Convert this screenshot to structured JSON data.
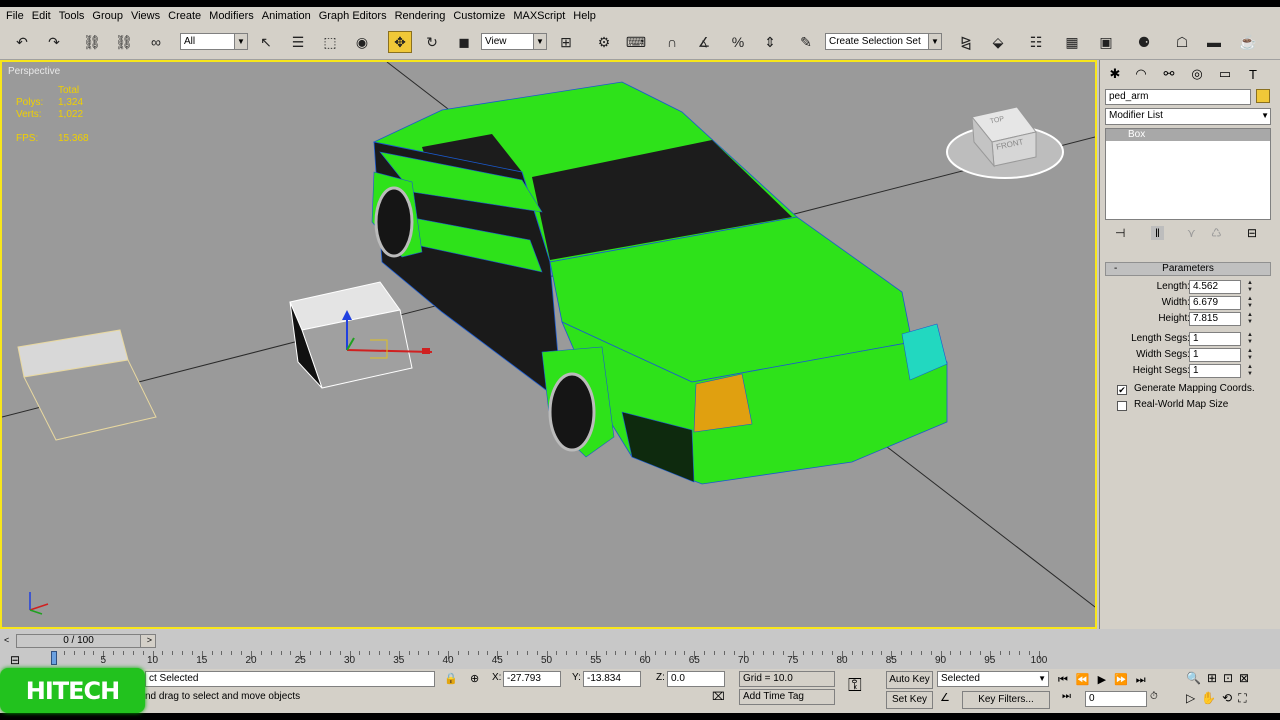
{
  "menu": [
    "File",
    "Edit",
    "Tools",
    "Group",
    "Views",
    "Create",
    "Modifiers",
    "Animation",
    "Graph Editors",
    "Rendering",
    "Customize",
    "MAXScript",
    "Help"
  ],
  "toolbar": {
    "filter_value": "All",
    "ref_coord_value": "View",
    "selection_set_placeholder": "Create Selection Set"
  },
  "viewport": {
    "label": "Perspective",
    "stats_header": "Total",
    "polys_label": "Polys:",
    "polys_value": "1,324",
    "verts_label": "Verts:",
    "verts_value": "1,022",
    "fps_label": "FPS:",
    "fps_value": "15.368",
    "viewcube_top": "TOP",
    "viewcube_front": "FRONT"
  },
  "command_panel": {
    "object_name": "ped_arm",
    "object_color": "#f0c838",
    "modifier_list_label": "Modifier List",
    "stack_item": "Box",
    "rollout_title": "Parameters",
    "params": [
      {
        "label": "Length:",
        "value": "4.562"
      },
      {
        "label": "Width:",
        "value": "6.679"
      },
      {
        "label": "Height:",
        "value": "7.815"
      },
      {
        "label": "Length Segs:",
        "value": "1"
      },
      {
        "label": "Width Segs:",
        "value": "1"
      },
      {
        "label": "Height Segs:",
        "value": "1"
      }
    ],
    "generate_mapping_label": "Generate Mapping Coords.",
    "generate_mapping_checked": "✔",
    "real_world_label": "Real-World Map Size"
  },
  "timeline": {
    "frame_display": "0 / 100",
    "ticks": [
      "0",
      "5",
      "10",
      "15",
      "20",
      "25",
      "30",
      "35",
      "40",
      "45",
      "50",
      "55",
      "60",
      "65",
      "70",
      "75",
      "80",
      "85",
      "90",
      "95",
      "100"
    ]
  },
  "status": {
    "selection_text": "ct Selected",
    "prompt_text": "nd drag to select and move objects",
    "x_label": "X:",
    "x_value": "-27.793",
    "y_label": "Y:",
    "y_value": "-13.834",
    "z_label": "Z:",
    "z_value": "0.0",
    "grid_text": "Grid = 10.0",
    "add_time_tag": "Add Time Tag",
    "auto_key": "Auto Key",
    "set_key": "Set Key",
    "selected_dropdown": "Selected",
    "key_filters": "Key Filters...",
    "current_frame": "0"
  },
  "watermark": "HITECH",
  "colors": {
    "car_body": "#2ee21a",
    "car_glass": "#1c1c1c",
    "viewport_bg": "#9a9a9a",
    "active_border": "#f8e61a",
    "turn_light": "#e0a010",
    "headlight": "#22d8c0"
  }
}
